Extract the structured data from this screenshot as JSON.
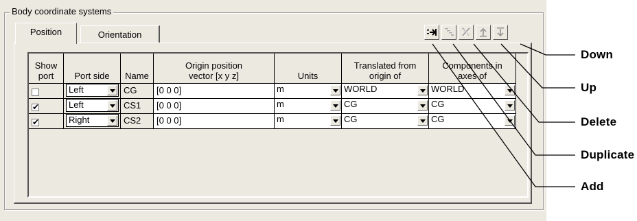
{
  "group_label": "Body coordinate systems",
  "tabs": [
    {
      "label": "Position",
      "active": true
    },
    {
      "label": "Orientation",
      "active": false
    }
  ],
  "toolbar": [
    {
      "name": "add",
      "icon": "add-row-icon",
      "enabled": true
    },
    {
      "name": "duplicate",
      "icon": "duplicate-row-icon",
      "enabled": false
    },
    {
      "name": "delete",
      "icon": "delete-icon",
      "enabled": false
    },
    {
      "name": "up",
      "icon": "move-up-icon",
      "enabled": false
    },
    {
      "name": "down",
      "icon": "move-down-icon",
      "enabled": false
    }
  ],
  "table": {
    "headers": {
      "show_port": "Show\nport",
      "port_side": "Port side",
      "name": "Name",
      "origin": "Origin position\nvector [x y z]",
      "units": "Units",
      "translated": "Translated from\norigin of",
      "components": "Components in\naxes of"
    },
    "rows": [
      {
        "show": false,
        "side": "Left",
        "name": "CG",
        "vector": "[0 0 0]",
        "units": "m",
        "translated": "WORLD",
        "components": "WORLD"
      },
      {
        "show": true,
        "side": "Left",
        "name": "CS1",
        "vector": "[0 0 0]",
        "units": "m",
        "translated": "CG",
        "components": "CG"
      },
      {
        "show": true,
        "side": "Right",
        "name": "CS2",
        "vector": "[0 0 0]",
        "units": "m",
        "translated": "CG",
        "components": "CG"
      }
    ]
  },
  "callouts": {
    "down": "Down",
    "up": "Up",
    "delete": "Delete",
    "duplicate": "Duplicate",
    "add": "Add"
  }
}
